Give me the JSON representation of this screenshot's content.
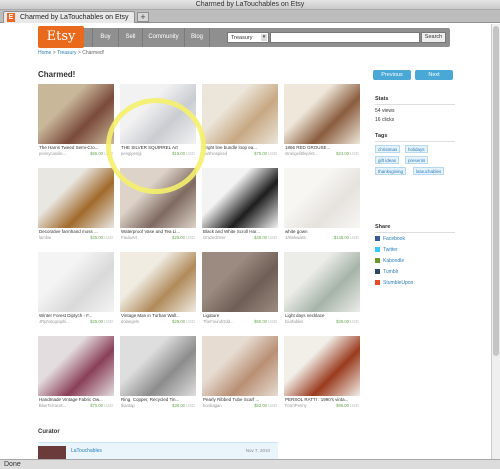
{
  "window": {
    "title": "Charmed by LaTouchables on Etsy"
  },
  "tab": {
    "label": "Charmed by LaTouchables on Etsy",
    "favicon": "E"
  },
  "status": "Done",
  "site": {
    "logo": "Etsy",
    "nav": [
      "Buy",
      "Sell",
      "Community",
      "Blog"
    ],
    "search_category": "Treasury",
    "search_button": "Search"
  },
  "breadcrumb": {
    "home": "Home",
    "sep1": " > ",
    "treasury": "Treasury",
    "sep2": " > ",
    "current": "Charmed!"
  },
  "page": {
    "title": "Charmed!",
    "prev": "Previous",
    "next": "Next"
  },
  "items": [
    {
      "title": "The Harris Tweed Semi-Cro...",
      "shop": "pennycandie...",
      "price": "$65.00",
      "currency": "USD",
      "colors": [
        "#7a4a3a",
        "#c9b79a"
      ]
    },
    {
      "title": "THE SILVER SQUIRREL Art",
      "shop": "pengipengi",
      "price": "$15.00",
      "currency": "USD",
      "colors": [
        "#c9ccd1",
        "#f2f2f2"
      ]
    },
    {
      "title": "bright line bundle loop ea...",
      "shop": "earthinspired",
      "price": "$75.00",
      "currency": "USD",
      "colors": [
        "#c7a883",
        "#ece6da"
      ]
    },
    {
      "title": "1866 RED GROUSE...",
      "shop": "strangelittleprint...",
      "price": "$24.00",
      "currency": "USD",
      "colors": [
        "#8a5c3e",
        "#efe8da"
      ]
    },
    {
      "title": "Decorative farmhand moss ...",
      "shop": "lambie",
      "price": "$25.00",
      "currency": "USD",
      "colors": [
        "#a16a2c",
        "#e9e7e2"
      ]
    },
    {
      "title": "Waterproof Vase and Tea Li...",
      "shop": "PaulaArt",
      "price": "$25.00",
      "currency": "USD",
      "colors": [
        "#7f6a60",
        "#ddd3c8"
      ]
    },
    {
      "title": "Black and White Scroll Har...",
      "shop": "GrazedOver",
      "price": "$48.00",
      "currency": "USD",
      "colors": [
        "#1d1d1d",
        "#f3f3f3"
      ]
    },
    {
      "title": "white gown",
      "shop": "1/8inkwaits",
      "price": "$145.00",
      "currency": "USD",
      "colors": [
        "#e6e3de",
        "#f7f6f3"
      ]
    },
    {
      "title": "Winter Forest Diptych - F...",
      "shop": "JRphotographi...",
      "price": "$25.00",
      "currency": "USD",
      "colors": [
        "#d9d9d9",
        "#f4f4f4"
      ]
    },
    {
      "title": "Vintage Man in Turban Wall...",
      "shop": "dolangels",
      "price": "$25.00",
      "currency": "USD",
      "colors": [
        "#b08a5a",
        "#f0ece2"
      ]
    },
    {
      "title": "Ligature",
      "shop": "TheFoundOdd...",
      "price": "$50.00",
      "currency": "USD",
      "colors": [
        "#6e5e55",
        "#9c8b80"
      ]
    },
    {
      "title": "Light days necklace",
      "shop": "fourfables",
      "price": "$36.00",
      "currency": "USD",
      "colors": [
        "#a6b4a8",
        "#ecece9"
      ]
    },
    {
      "title": "Handmade Vintage Fabric Ow...",
      "shop": "BlueTerracot...",
      "price": "$70.00",
      "currency": "USD",
      "colors": [
        "#8a3f58",
        "#e3dde0"
      ]
    },
    {
      "title": "Ring. Copper, Recycled Tin...",
      "shop": "tkaotap",
      "price": "$36.00",
      "currency": "USD",
      "colors": [
        "#8c8c8c",
        "#dedede"
      ]
    },
    {
      "title": "Pearly Ribbed Tube Scarf ...",
      "shop": "bonbagan",
      "price": "$82.00",
      "currency": "USD",
      "colors": [
        "#b98f74",
        "#e6dcd2"
      ]
    },
    {
      "title": "PERSOL RATTI : 1990's vinta...",
      "shop": "FromPenny",
      "price": "$95.00",
      "currency": "USD",
      "colors": [
        "#9a3b1e",
        "#f2efe9"
      ]
    }
  ],
  "sidebar": {
    "stats_heading": "Stats",
    "views": "54 views",
    "clicks": "16 clicks",
    "tags_heading": "Tags",
    "tags": [
      "christmas",
      "holidays",
      "gift ideas",
      "presents",
      "thanksgiving",
      "latouchables"
    ],
    "share_heading": "Share",
    "share": [
      {
        "label": "Facebook",
        "color": "#3b5998"
      },
      {
        "label": "Twitter",
        "color": "#33ccff"
      },
      {
        "label": "Kaboodle",
        "color": "#6a9a2a"
      },
      {
        "label": "Tumblr",
        "color": "#2c4762"
      },
      {
        "label": "StumbleUpon",
        "color": "#eb4924"
      }
    ]
  },
  "curator": {
    "heading": "Curator",
    "name": "LaTouchables",
    "date": "Nov 7, 2010"
  }
}
